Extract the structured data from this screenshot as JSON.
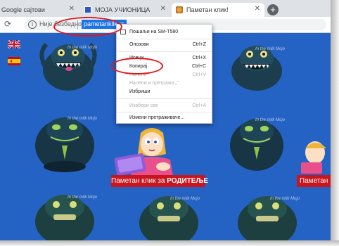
{
  "tabs": [
    {
      "title": "Google сајтови",
      "active": false
    },
    {
      "title": "МОЈА УЧИОНИЦА",
      "active": false
    },
    {
      "title": "Паметан клик!",
      "active": true
    }
  ],
  "toolbar": {
    "security_text": "Није безбедно",
    "url": "pametanklik.rs"
  },
  "page": {
    "brand_small": "In the milk Mojo",
    "banner_prefix": "Паметан клик за",
    "banner_bold": "РОДИТЕЉЕ",
    "banner2_text": "Паметан"
  },
  "context_menu": {
    "items": [
      {
        "label": "Пошаљи на SM-T580",
        "shortcut": "",
        "disabled": false
      },
      {
        "label": "Опозови",
        "shortcut": "Ctrl+Z",
        "disabled": false
      },
      {
        "label": "Исеци",
        "shortcut": "Ctrl+X",
        "disabled": false
      },
      {
        "label": "Копирај",
        "shortcut": "Ctrl+C",
        "disabled": false
      },
      {
        "label": "Налепи",
        "shortcut": "Ctrl+V",
        "disabled": true
      },
      {
        "label": "Налепи и претражи „“",
        "shortcut": "",
        "disabled": true
      },
      {
        "label": "Избриши",
        "shortcut": "",
        "disabled": false
      },
      {
        "label": "Изабери све",
        "shortcut": "Ctrl+A",
        "disabled": true
      },
      {
        "label": "Измени претраживаче...",
        "shortcut": "",
        "disabled": false
      }
    ]
  },
  "colors": {
    "page_bg": "#2463c4",
    "banner_red": "#c9151e",
    "annotation_red": "#e3141b",
    "url_highlight": "#1a73e8"
  }
}
